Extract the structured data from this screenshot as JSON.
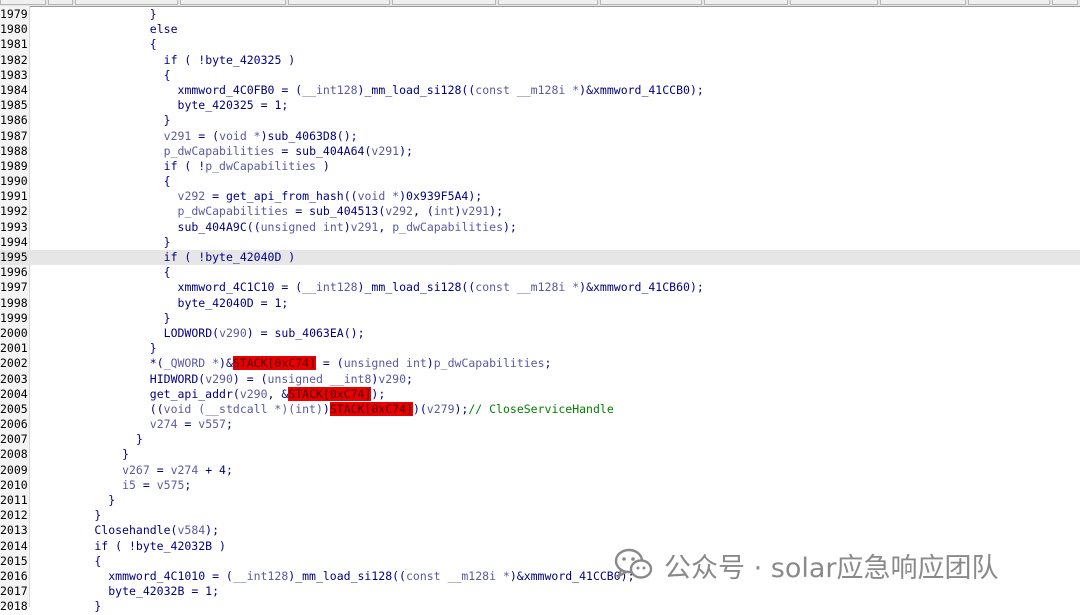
{
  "watermark": {
    "text": "公众号 · solar应急响应团队",
    "icon": "wechat-icon"
  },
  "colors": {
    "highlight": "#e80000",
    "current_line": "#e6e6e6",
    "comment": "#008000"
  },
  "current_line": 1995,
  "lines": [
    {
      "n": "1979",
      "ind": 17,
      "t": [
        [
          "}",
          "punc"
        ]
      ]
    },
    {
      "n": "1980",
      "ind": 17,
      "t": [
        [
          "else",
          "kw"
        ]
      ]
    },
    {
      "n": "1981",
      "ind": 17,
      "t": [
        [
          "{",
          "punc"
        ]
      ]
    },
    {
      "n": "1982",
      "ind": 19,
      "t": [
        [
          "if ( !",
          "kw"
        ],
        [
          "byte_420325",
          "ident"
        ],
        [
          " )",
          "punc"
        ]
      ]
    },
    {
      "n": "1983",
      "ind": 19,
      "t": [
        [
          "{",
          "punc"
        ]
      ]
    },
    {
      "n": "1984",
      "ind": 21,
      "t": [
        [
          "xmmword_4C0FB0",
          "ident"
        ],
        [
          " = (",
          "punc"
        ],
        [
          "__int128",
          "var"
        ],
        [
          ")",
          "punc"
        ],
        [
          "_mm_load_si128",
          "ident"
        ],
        [
          "((",
          "punc"
        ],
        [
          "const __m128i *",
          "var"
        ],
        [
          ")&",
          "punc"
        ],
        [
          "xmmword_41CCB0",
          "ident"
        ],
        [
          ");",
          "punc"
        ]
      ]
    },
    {
      "n": "1985",
      "ind": 21,
      "t": [
        [
          "byte_420325",
          "ident"
        ],
        [
          " = ",
          "punc"
        ],
        [
          "1",
          "plain"
        ],
        [
          ";",
          "punc"
        ]
      ]
    },
    {
      "n": "1986",
      "ind": 19,
      "t": [
        [
          "}",
          "punc"
        ]
      ]
    },
    {
      "n": "1987",
      "ind": 19,
      "t": [
        [
          "v291",
          "var"
        ],
        [
          " = (",
          "punc"
        ],
        [
          "void *",
          "var"
        ],
        [
          ")",
          "punc"
        ],
        [
          "sub_4063D8",
          "ident"
        ],
        [
          "();",
          "punc"
        ]
      ]
    },
    {
      "n": "1988",
      "ind": 19,
      "t": [
        [
          "p_dwCapabilities",
          "var"
        ],
        [
          " = ",
          "punc"
        ],
        [
          "sub_404A64",
          "ident"
        ],
        [
          "(",
          "punc"
        ],
        [
          "v291",
          "var"
        ],
        [
          ");",
          "punc"
        ]
      ]
    },
    {
      "n": "1989",
      "ind": 19,
      "t": [
        [
          "if ( !",
          "kw"
        ],
        [
          "p_dwCapabilities",
          "var"
        ],
        [
          " )",
          "punc"
        ]
      ]
    },
    {
      "n": "1990",
      "ind": 19,
      "t": [
        [
          "{",
          "punc"
        ]
      ]
    },
    {
      "n": "1991",
      "ind": 21,
      "t": [
        [
          "v292",
          "var"
        ],
        [
          " = ",
          "punc"
        ],
        [
          "get_api_from_hash",
          "ident"
        ],
        [
          "((",
          "punc"
        ],
        [
          "void *",
          "var"
        ],
        [
          ")",
          "punc"
        ],
        [
          "0x939F5A4",
          "plain"
        ],
        [
          ");",
          "punc"
        ]
      ]
    },
    {
      "n": "1992",
      "ind": 21,
      "t": [
        [
          "p_dwCapabilities",
          "var"
        ],
        [
          " = ",
          "punc"
        ],
        [
          "sub_404513",
          "ident"
        ],
        [
          "(",
          "punc"
        ],
        [
          "v292",
          "var"
        ],
        [
          ", (",
          "punc"
        ],
        [
          "int",
          "var"
        ],
        [
          ")",
          "punc"
        ],
        [
          "v291",
          "var"
        ],
        [
          ");",
          "punc"
        ]
      ]
    },
    {
      "n": "1993",
      "ind": 21,
      "t": [
        [
          "sub_404A9C",
          "ident"
        ],
        [
          "((",
          "punc"
        ],
        [
          "unsigned int",
          "var"
        ],
        [
          ")",
          "punc"
        ],
        [
          "v291",
          "var"
        ],
        [
          ", ",
          "punc"
        ],
        [
          "p_dwCapabilities",
          "var"
        ],
        [
          ");",
          "punc"
        ]
      ]
    },
    {
      "n": "1994",
      "ind": 19,
      "t": [
        [
          "}",
          "punc"
        ]
      ]
    },
    {
      "n": "1995",
      "ind": 19,
      "t": [
        [
          "if ( !",
          "kw"
        ],
        [
          "byte_42040D",
          "ident"
        ],
        [
          " )",
          "punc"
        ]
      ]
    },
    {
      "n": "1996",
      "ind": 19,
      "t": [
        [
          "{",
          "punc"
        ]
      ]
    },
    {
      "n": "1997",
      "ind": 21,
      "t": [
        [
          "xmmword_4C1C10",
          "ident"
        ],
        [
          " = (",
          "punc"
        ],
        [
          "__int128",
          "var"
        ],
        [
          ")",
          "punc"
        ],
        [
          "_mm_load_si128",
          "ident"
        ],
        [
          "((",
          "punc"
        ],
        [
          "const __m128i *",
          "var"
        ],
        [
          ")&",
          "punc"
        ],
        [
          "xmmword_41CB60",
          "ident"
        ],
        [
          ");",
          "punc"
        ]
      ]
    },
    {
      "n": "1998",
      "ind": 21,
      "t": [
        [
          "byte_42040D",
          "ident"
        ],
        [
          " = ",
          "punc"
        ],
        [
          "1",
          "plain"
        ],
        [
          ";",
          "punc"
        ]
      ]
    },
    {
      "n": "1999",
      "ind": 19,
      "t": [
        [
          "}",
          "punc"
        ]
      ]
    },
    {
      "n": "2000",
      "ind": 19,
      "t": [
        [
          "LODWORD",
          "ident"
        ],
        [
          "(",
          "punc"
        ],
        [
          "v290",
          "var"
        ],
        [
          ") = ",
          "punc"
        ],
        [
          "sub_4063EA",
          "ident"
        ],
        [
          "();",
          "punc"
        ]
      ]
    },
    {
      "n": "2001",
      "ind": 17,
      "t": [
        [
          "}",
          "punc"
        ]
      ]
    },
    {
      "n": "2002",
      "ind": 17,
      "t": [
        [
          "*(",
          "punc"
        ],
        [
          "_QWORD *",
          "var"
        ],
        [
          ")&",
          "punc"
        ],
        [
          "STACK[0xC74]",
          "hl"
        ],
        [
          " = (",
          "punc"
        ],
        [
          "unsigned int",
          "var"
        ],
        [
          ")",
          "punc"
        ],
        [
          "p_dwCapabilities",
          "var"
        ],
        [
          ";",
          "punc"
        ]
      ]
    },
    {
      "n": "2003",
      "ind": 17,
      "t": [
        [
          "HIDWORD",
          "ident"
        ],
        [
          "(",
          "punc"
        ],
        [
          "v290",
          "var"
        ],
        [
          ") = (",
          "punc"
        ],
        [
          "unsigned __int8",
          "var"
        ],
        [
          ")",
          "punc"
        ],
        [
          "v290",
          "var"
        ],
        [
          ";",
          "punc"
        ]
      ]
    },
    {
      "n": "2004",
      "ind": 17,
      "t": [
        [
          "get_api_addr",
          "ident"
        ],
        [
          "(",
          "punc"
        ],
        [
          "v290",
          "var"
        ],
        [
          ", &",
          "punc"
        ],
        [
          "STACK[0xC74]",
          "hl"
        ],
        [
          ");",
          "punc"
        ]
      ]
    },
    {
      "n": "2005",
      "ind": 17,
      "t": [
        [
          "((",
          "punc"
        ],
        [
          "void (__stdcall *)(int)",
          "var"
        ],
        [
          ")",
          "punc"
        ],
        [
          "STACK[0xC74]",
          "hl"
        ],
        [
          ")(",
          "punc"
        ],
        [
          "v279",
          "var"
        ],
        [
          ");",
          "punc"
        ],
        [
          "// CloseServiceHandle",
          "cmt"
        ]
      ]
    },
    {
      "n": "2006",
      "ind": 17,
      "t": [
        [
          "v274",
          "var"
        ],
        [
          " = ",
          "punc"
        ],
        [
          "v557",
          "var"
        ],
        [
          ";",
          "punc"
        ]
      ]
    },
    {
      "n": "2007",
      "ind": 15,
      "t": [
        [
          "}",
          "punc"
        ]
      ]
    },
    {
      "n": "2008",
      "ind": 13,
      "t": [
        [
          "}",
          "punc"
        ]
      ]
    },
    {
      "n": "2009",
      "ind": 13,
      "t": [
        [
          "v267",
          "var"
        ],
        [
          " = ",
          "punc"
        ],
        [
          "v274",
          "var"
        ],
        [
          " + ",
          "punc"
        ],
        [
          "4",
          "plain"
        ],
        [
          ";",
          "punc"
        ]
      ]
    },
    {
      "n": "2010",
      "ind": 13,
      "t": [
        [
          "i5",
          "var"
        ],
        [
          " = ",
          "punc"
        ],
        [
          "v575",
          "var"
        ],
        [
          ";",
          "punc"
        ]
      ]
    },
    {
      "n": "2011",
      "ind": 11,
      "t": [
        [
          "}",
          "punc"
        ]
      ]
    },
    {
      "n": "2012",
      "ind": 9,
      "t": [
        [
          "}",
          "punc"
        ]
      ]
    },
    {
      "n": "2013",
      "ind": 9,
      "t": [
        [
          "Closehandle",
          "ident"
        ],
        [
          "(",
          "punc"
        ],
        [
          "v584",
          "var"
        ],
        [
          ");",
          "punc"
        ]
      ]
    },
    {
      "n": "2014",
      "ind": 9,
      "t": [
        [
          "if ( !",
          "kw"
        ],
        [
          "byte_42032B",
          "ident"
        ],
        [
          " )",
          "punc"
        ]
      ]
    },
    {
      "n": "2015",
      "ind": 9,
      "t": [
        [
          "{",
          "punc"
        ]
      ]
    },
    {
      "n": "2016",
      "ind": 11,
      "t": [
        [
          "xmmword_4C1010",
          "ident"
        ],
        [
          " = (",
          "punc"
        ],
        [
          "__int128",
          "var"
        ],
        [
          ")",
          "punc"
        ],
        [
          "_mm_load_si128",
          "ident"
        ],
        [
          "((",
          "punc"
        ],
        [
          "const __m128i *",
          "var"
        ],
        [
          ")&",
          "punc"
        ],
        [
          "xmmword_41CCB0",
          "ident"
        ],
        [
          ");",
          "punc"
        ]
      ]
    },
    {
      "n": "2017",
      "ind": 11,
      "t": [
        [
          "byte_42032B",
          "ident"
        ],
        [
          " = ",
          "punc"
        ],
        [
          "1",
          "plain"
        ],
        [
          ";",
          "punc"
        ]
      ]
    },
    {
      "n": "2018",
      "ind": 9,
      "t": [
        [
          "}",
          "punc"
        ]
      ]
    }
  ]
}
